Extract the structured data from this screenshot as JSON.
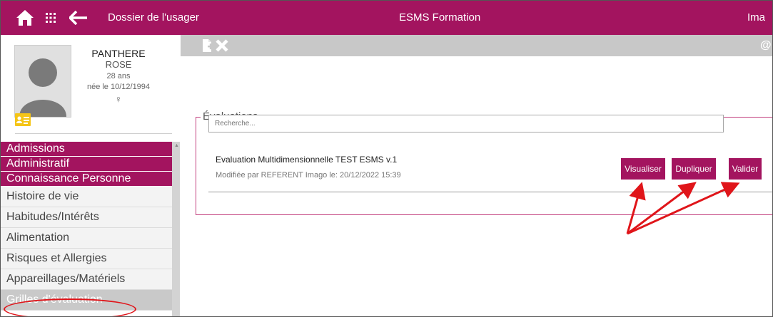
{
  "header": {
    "title": "Dossier de l'usager",
    "center": "ESMS Formation",
    "right": "Ima"
  },
  "profile": {
    "last_name": "PANTHERE",
    "first_name": "ROSE",
    "age": "28 ans",
    "birth": "née le 10/12/1994",
    "sex_symbol": "♀"
  },
  "menu": {
    "items": [
      {
        "label": "Admissions"
      },
      {
        "label": "Administratif"
      },
      {
        "label": "Connaissance Personne"
      },
      {
        "label": "Histoire de vie"
      },
      {
        "label": "Habitudes/Intérêts"
      },
      {
        "label": "Alimentation"
      },
      {
        "label": "Risques et Allergies"
      },
      {
        "label": "Appareillages/Matériels"
      },
      {
        "label": "Grilles d'évaluation"
      }
    ]
  },
  "evaluations": {
    "legend": "Évaluations",
    "search_placeholder": "Recherche...",
    "item": {
      "title": "Evaluation Multidimensionnelle TEST ESMS v.1",
      "meta": "Modifiée par REFERENT Imago le: 20/12/2022 15:39"
    },
    "buttons": {
      "view": "Visualiser",
      "duplicate": "Dupliquer",
      "validate": "Valider"
    }
  },
  "toolbar": {
    "right_symbol": "@"
  },
  "colors": {
    "brand": "#a3145f",
    "annotation": "#e0151a"
  }
}
